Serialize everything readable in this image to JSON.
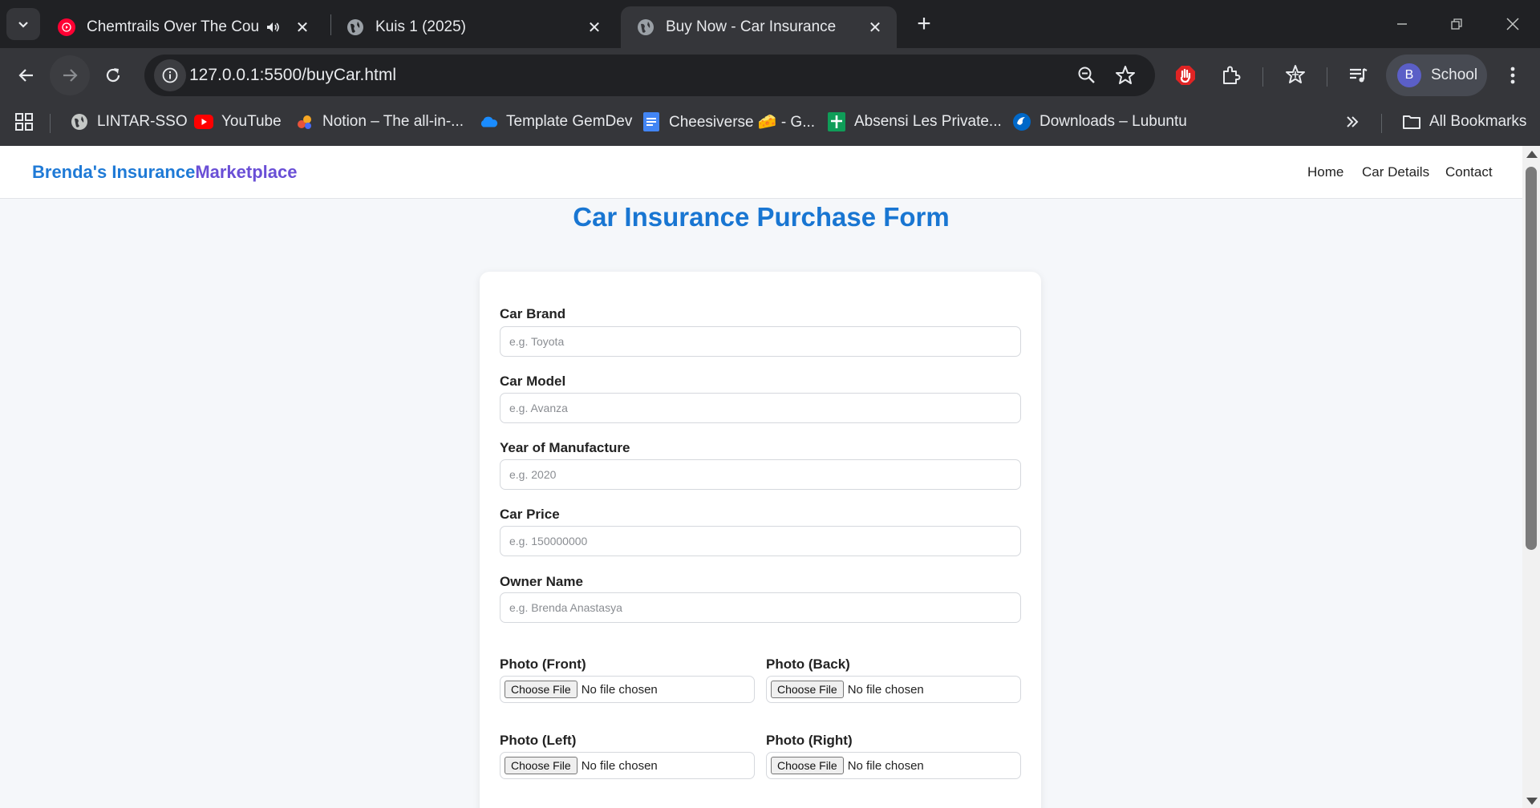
{
  "tabs": [
    {
      "title": "Chemtrails Over The Country",
      "active": false,
      "audio": true
    },
    {
      "title": "Kuis 1 (2025)",
      "active": false
    },
    {
      "title": "Buy Now - Car Insurance",
      "active": true
    }
  ],
  "address": {
    "url": "127.0.0.1:5500/buyCar.html"
  },
  "profile": {
    "initial": "B",
    "name": "School"
  },
  "bookmarks": [
    {
      "label": "LINTAR-SSO",
      "icon": "globe-icon"
    },
    {
      "label": "YouTube",
      "icon": "youtube-icon"
    },
    {
      "label": "Notion – The all-in-...",
      "icon": "notion-icon"
    },
    {
      "label": "Template GemDev",
      "icon": "onedrive-icon"
    },
    {
      "label": "Cheesiverse 🧀 - G...",
      "icon": "docs-icon"
    },
    {
      "label": "Absensi Les Private...",
      "icon": "sheets-icon"
    },
    {
      "label": "Downloads – Lubuntu",
      "icon": "lubuntu-icon"
    }
  ],
  "all_bookmarks_label": "All Bookmarks",
  "site": {
    "brand_part1": "Brenda's Insurance",
    "brand_part2": "Marketplace",
    "nav": [
      "Home",
      "Car Details",
      "Contact"
    ],
    "page_title": "Car Insurance Purchase Form"
  },
  "form": {
    "fields": [
      {
        "label": "Car Brand",
        "placeholder": "e.g. Toyota"
      },
      {
        "label": "Car Model",
        "placeholder": "e.g. Avanza"
      },
      {
        "label": "Year of Manufacture",
        "placeholder": "e.g. 2020"
      },
      {
        "label": "Car Price",
        "placeholder": "e.g. 150000000"
      },
      {
        "label": "Owner Name",
        "placeholder": "e.g. Brenda Anastasya"
      }
    ],
    "photos": [
      {
        "label": "Photo (Front)",
        "button": "Choose File",
        "status": "No file chosen"
      },
      {
        "label": "Photo (Back)",
        "button": "Choose File",
        "status": "No file chosen"
      },
      {
        "label": "Photo (Left)",
        "button": "Choose File",
        "status": "No file chosen"
      },
      {
        "label": "Photo (Right)",
        "button": "Choose File",
        "status": "No file chosen"
      }
    ]
  },
  "colors": {
    "brand_blue": "#1f7ad6",
    "brand_purple": "#6a4fd6",
    "title_blue": "#1976d2",
    "chrome_dark": "#202124",
    "chrome_toolbar": "#35363a"
  }
}
